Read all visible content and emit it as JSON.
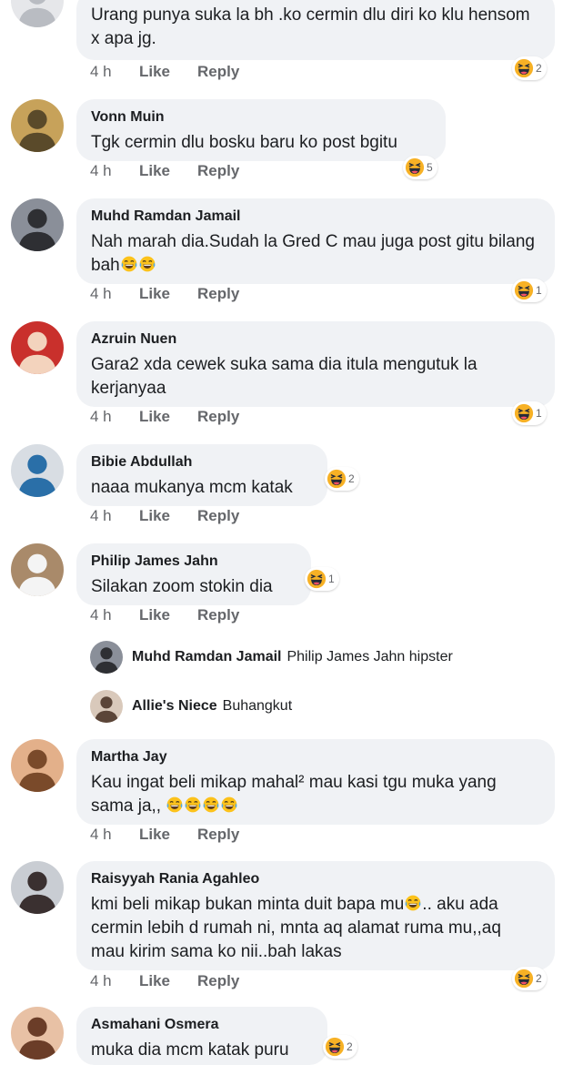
{
  "actions": {
    "like": "Like",
    "reply": "Reply"
  },
  "comments": [
    {
      "author": "",
      "text": "Urang punya suka la bh .ko cermin dlu diri ko klu hensom x apa jg.",
      "time": "4 h",
      "reactions": "2"
    },
    {
      "author": "Vonn Muin",
      "text": "Tgk cermin dlu bosku baru ko post bgitu",
      "time": "4 h",
      "reactions": "5"
    },
    {
      "author": "Muhd Ramdan Jamail",
      "text": "Nah marah dia.Sudah la Gred C mau juga post gitu bilang bah",
      "time": "4 h",
      "reactions": "1"
    },
    {
      "author": "Azruin Nuen",
      "text": "Gara2 xda cewek suka sama dia itula mengutuk la kerjanyaa",
      "time": "4 h",
      "reactions": "1"
    },
    {
      "author": "Bibie Abdullah",
      "text": "naaa mukanya mcm katak",
      "time": "4 h",
      "reactions": "2"
    },
    {
      "author": "Philip James Jahn",
      "text": "Silakan zoom stokin dia",
      "time": "4 h",
      "reactions": "1"
    },
    {
      "author": "Martha Jay",
      "text": "Kau ingat beli mikap mahal² mau kasi tgu muka yang sama ja,,",
      "time": "4 h",
      "reactions": ""
    },
    {
      "author": "Raisyyah Rania Agahleo",
      "text_a": "kmi beli mikap bukan minta duit bapa mu",
      "text_b": ".. aku ada cermin lebih d rumah ni, mnta aq alamat ruma mu,,aq mau kirim sama ko nii..bah lakas",
      "time": "4 h",
      "reactions": "2"
    },
    {
      "author": "Asmahani Osmera",
      "text": "muka dia mcm katak puru",
      "reactions": "2"
    }
  ],
  "replies": [
    {
      "author": "Muhd Ramdan Jamail",
      "text": "Philip James Jahn hipster"
    },
    {
      "author": "Allie's Niece",
      "text": "Buhangkut"
    }
  ],
  "icons": {
    "reaction": "laugh-emoji-icon",
    "inline_emoji": "tears-of-joy-emoji-icon"
  }
}
